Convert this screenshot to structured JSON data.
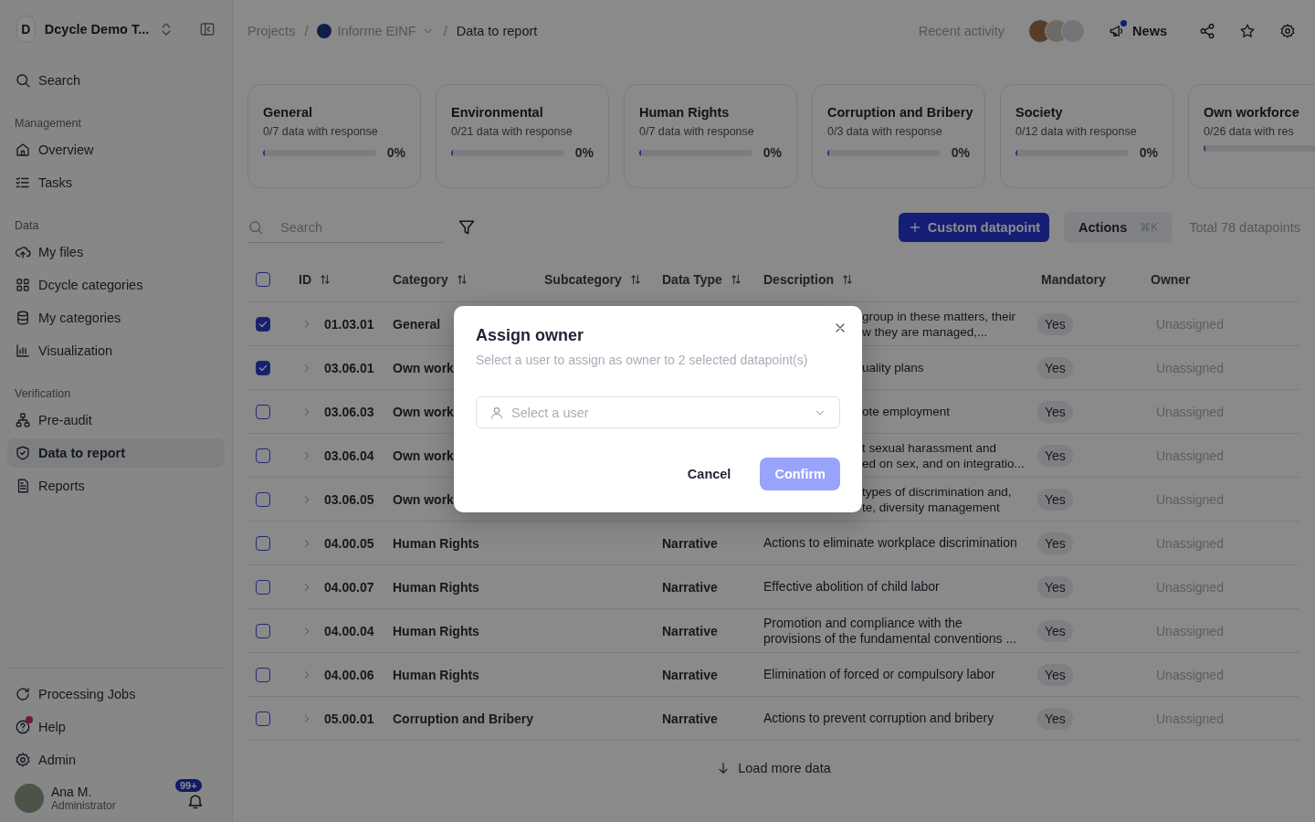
{
  "sidebar": {
    "workspace": {
      "initial": "D",
      "name": "Dcycle Demo T..."
    },
    "search": "Search",
    "sections": [
      {
        "title": "Management",
        "items": [
          {
            "label": "Overview",
            "selected": false
          },
          {
            "label": "Tasks",
            "selected": false
          }
        ]
      },
      {
        "title": "Data",
        "items": [
          {
            "label": "My files",
            "selected": false
          },
          {
            "label": "Dcycle categories",
            "selected": false
          },
          {
            "label": "My categories",
            "selected": false
          },
          {
            "label": "Visualization",
            "selected": false
          }
        ]
      },
      {
        "title": "Verification",
        "items": [
          {
            "label": "Pre-audit",
            "selected": false
          },
          {
            "label": "Data to report",
            "selected": true
          },
          {
            "label": "Reports",
            "selected": false
          }
        ]
      }
    ],
    "footer_items": [
      {
        "label": "Processing Jobs",
        "dot": false
      },
      {
        "label": "Help",
        "dot": true
      },
      {
        "label": "Admin",
        "dot": false
      }
    ],
    "user": {
      "name": "Ana M.",
      "role": "Administrator",
      "notifications": "99+"
    }
  },
  "header": {
    "separator": "/",
    "breadcrumb": [
      {
        "label": "Projects",
        "kind": "link"
      },
      {
        "label": "Informe EINF",
        "kind": "project"
      },
      {
        "label": "Data to report",
        "kind": "current"
      }
    ],
    "recent_activity": "Recent activity",
    "news": {
      "label": "News",
      "unread": true
    }
  },
  "cards": [
    {
      "title": "General",
      "subtitle": "0/7 data with response",
      "percent": "0%",
      "level": 0
    },
    {
      "title": "Environmental",
      "subtitle": "0/21 data with response",
      "percent": "0%",
      "level": 0
    },
    {
      "title": "Human Rights",
      "subtitle": "0/7 data with response",
      "percent": "0%",
      "level": 0
    },
    {
      "title": "Corruption and Bribery",
      "subtitle": "0/3 data with response",
      "percent": "0%",
      "level": 0
    },
    {
      "title": "Society",
      "subtitle": "0/12 data with response",
      "percent": "0%",
      "level": 0
    },
    {
      "title": "Own workforce",
      "subtitle": "0/26 data with res",
      "level": 0
    }
  ],
  "toolbar": {
    "search_placeholder": "Search",
    "primary_button": "Custom datapoint",
    "actions_button": "Actions",
    "shortcut": "⌘K",
    "total": "Total 78 datapoints"
  },
  "table": {
    "header_checked": false,
    "columns": [
      {
        "label": "ID",
        "sortable": true
      },
      {
        "label": "Category",
        "sortable": true
      },
      {
        "label": "Subcategory",
        "sortable": true
      },
      {
        "label": "Data Type",
        "sortable": true
      },
      {
        "label": "Description",
        "sortable": true
      },
      {
        "label": "Mandatory",
        "sortable": false
      },
      {
        "label": "Owner",
        "sortable": false
      }
    ],
    "rows": [
      {
        "checked": true,
        "id": "01.03.01",
        "category": "General",
        "description": "group in these matters, their\nw they are managed,...",
        "mandatory": "Yes",
        "owner": "Unassigned",
        "covered": true
      },
      {
        "checked": true,
        "id": "03.06.01",
        "category": "Own work",
        "description": "uality plans",
        "mandatory": "Yes",
        "owner": "Unassigned",
        "covered": true
      },
      {
        "checked": false,
        "id": "03.06.03",
        "category": "Own work",
        "description": "ote employment",
        "mandatory": "Yes",
        "owner": "Unassigned",
        "covered": true
      },
      {
        "checked": false,
        "id": "03.06.04",
        "category": "Own work",
        "description": "t sexual harassment and\ned on sex, and on integratio...",
        "mandatory": "Yes",
        "owner": "Unassigned",
        "covered": true
      },
      {
        "checked": false,
        "id": "03.06.05",
        "category": "Own work",
        "description": "types of discrimination and,\nte, diversity management",
        "mandatory": "Yes",
        "owner": "Unassigned",
        "covered": true
      },
      {
        "checked": false,
        "id": "04.00.05",
        "category": "Human Rights",
        "data_type": "Narrative",
        "description": "Actions to eliminate workplace discrimination",
        "mandatory": "Yes",
        "owner": "Unassigned",
        "covered": false
      },
      {
        "checked": false,
        "id": "04.00.07",
        "category": "Human Rights",
        "data_type": "Narrative",
        "description": "Effective abolition of child labor",
        "mandatory": "Yes",
        "owner": "Unassigned",
        "covered": false
      },
      {
        "checked": false,
        "id": "04.00.04",
        "category": "Human Rights",
        "data_type": "Narrative",
        "description": "Promotion and compliance with the\nprovisions of the fundamental conventions ...",
        "mandatory": "Yes",
        "owner": "Unassigned",
        "covered": false
      },
      {
        "checked": false,
        "id": "04.00.06",
        "category": "Human Rights",
        "data_type": "Narrative",
        "description": "Elimination of forced or compulsory labor",
        "mandatory": "Yes",
        "owner": "Unassigned",
        "covered": false
      },
      {
        "checked": false,
        "id": "05.00.01",
        "category": "Corruption and Bribery",
        "data_type": "Narrative",
        "description": "Actions to prevent corruption and bribery",
        "mandatory": "Yes",
        "owner": "Unassigned",
        "covered": false
      }
    ],
    "load_more": "Load more data"
  },
  "modal": {
    "title": "Assign owner",
    "subtitle": "Select a user to assign as owner to 2 selected datapoint(s)",
    "select_placeholder": "Select a user",
    "cancel": "Cancel",
    "confirm": "Confirm",
    "confirm_disabled": true
  }
}
